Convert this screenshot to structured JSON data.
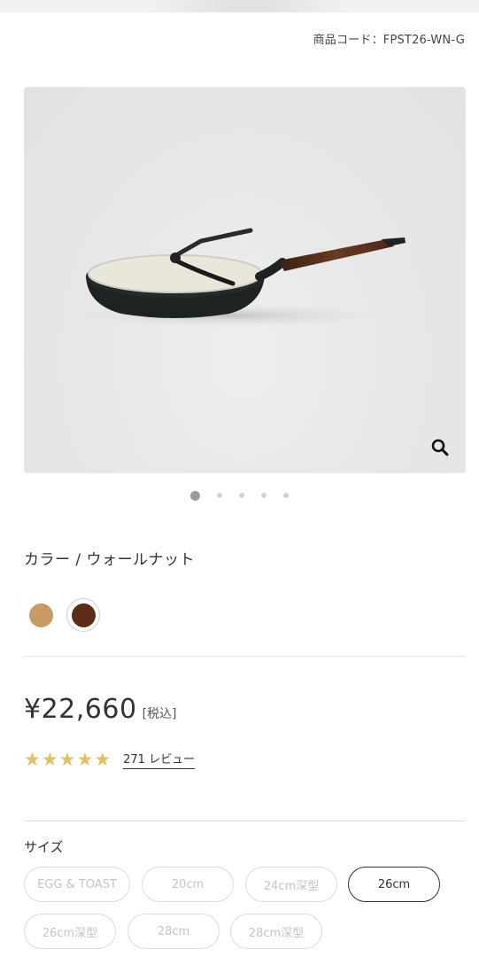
{
  "product": {
    "code": "商品コード：FPST26-WN-G"
  },
  "gallery": {
    "slide_count": 5,
    "active_slide": 1,
    "zoom_icon": "magnifier-icon"
  },
  "color": {
    "label": "カラー / ウォールナット",
    "options": [
      {
        "name": "natural",
        "hex": "#c99a62",
        "selected": false
      },
      {
        "name": "walnut",
        "hex": "#5b2d1a",
        "selected": true
      }
    ]
  },
  "price": {
    "amount": "¥22,660",
    "tax_label": "[税込]"
  },
  "rating": {
    "stars": 5,
    "star_color": "#e3c15c",
    "review_text": "271 レビュー"
  },
  "size": {
    "label": "サイズ",
    "options": [
      {
        "label": "EGG & TOAST",
        "selected": false,
        "available": false
      },
      {
        "label": "20cm",
        "selected": false,
        "available": false
      },
      {
        "label": "24cm深型",
        "selected": false,
        "available": false
      },
      {
        "label": "26cm",
        "selected": true,
        "available": true
      },
      {
        "label": "26cm深型",
        "selected": false,
        "available": false
      },
      {
        "label": "28cm",
        "selected": false,
        "available": false
      },
      {
        "label": "28cm深型",
        "selected": false,
        "available": false
      }
    ]
  }
}
